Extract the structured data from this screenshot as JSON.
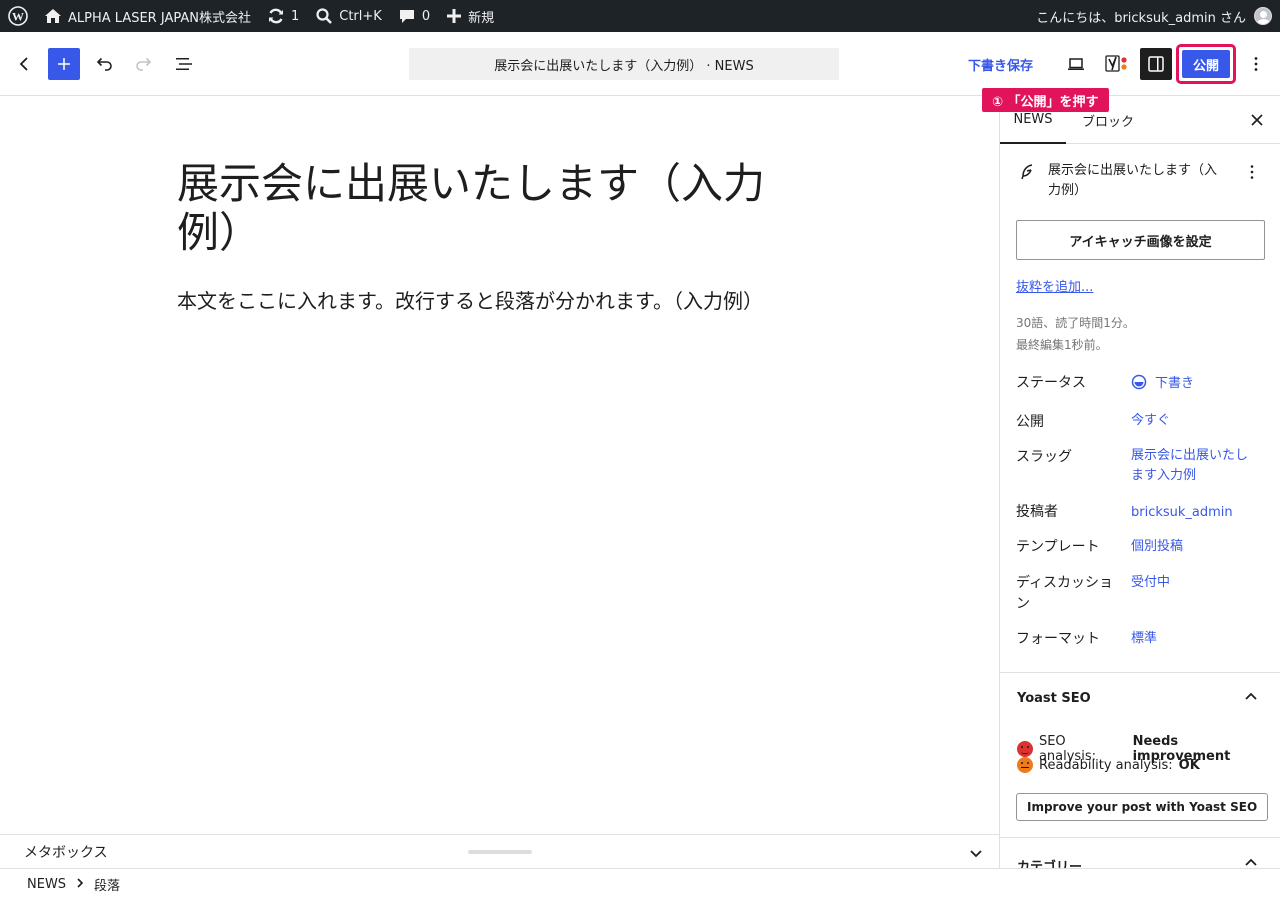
{
  "adminbar": {
    "site_name": "ALPHA LASER JAPAN株式会社",
    "updates_count": "1",
    "search_shortcut": "Ctrl+K",
    "comments_count": "0",
    "new_label": "新規",
    "greeting": "こんにちは、bricksuk_admin さん"
  },
  "header": {
    "document_title": "展示会に出展いたします（入力例） · NEWS",
    "save_draft_label": "下書き保存",
    "publish_label": "公開",
    "annotation": "① 「公開」を押す",
    "accent_color": "#3858e9",
    "annotation_color": "#e1135a"
  },
  "editor": {
    "title": "展示会に出展いたします（入力例）",
    "paragraph": "本文をここに入れます。改行すると段落が分かれます。（入力例）"
  },
  "metabox": {
    "label": "メタボックス"
  },
  "footer": {
    "breadcrumb": [
      "NEWS",
      "段落"
    ]
  },
  "sidebar": {
    "tabs": [
      {
        "label": "NEWS",
        "active": true
      },
      {
        "label": "ブロック",
        "active": false
      }
    ],
    "post_title": "展示会に出展いたします（入力例）",
    "featured_image_label": "アイキャッチ画像を設定",
    "excerpt_link": "抜粋を追加...",
    "word_count": "30語、読了時間1分。",
    "last_edited": "最終編集1秒前。",
    "rows": [
      {
        "label": "ステータス",
        "value": "下書き"
      },
      {
        "label": "公開",
        "value": "今すぐ"
      },
      {
        "label": "スラッグ",
        "value": "展示会に出展いたします入力例"
      },
      {
        "label": "投稿者",
        "value": "bricksuk_admin"
      },
      {
        "label": "テンプレート",
        "value": "個別投稿"
      },
      {
        "label": "ディスカッション",
        "value": "受付中"
      },
      {
        "label": "フォーマット",
        "value": "標準"
      }
    ],
    "yoast": {
      "title": "Yoast SEO",
      "seo_label": "SEO analysis:",
      "seo_value": "Needs improvement",
      "readability_label": "Readability analysis:",
      "readability_value": "OK",
      "improve_button": "Improve your post with Yoast SEO",
      "seo_color": "#dc3232",
      "readability_color": "#ee7c1b"
    },
    "category_panel_title": "カテゴリー"
  }
}
